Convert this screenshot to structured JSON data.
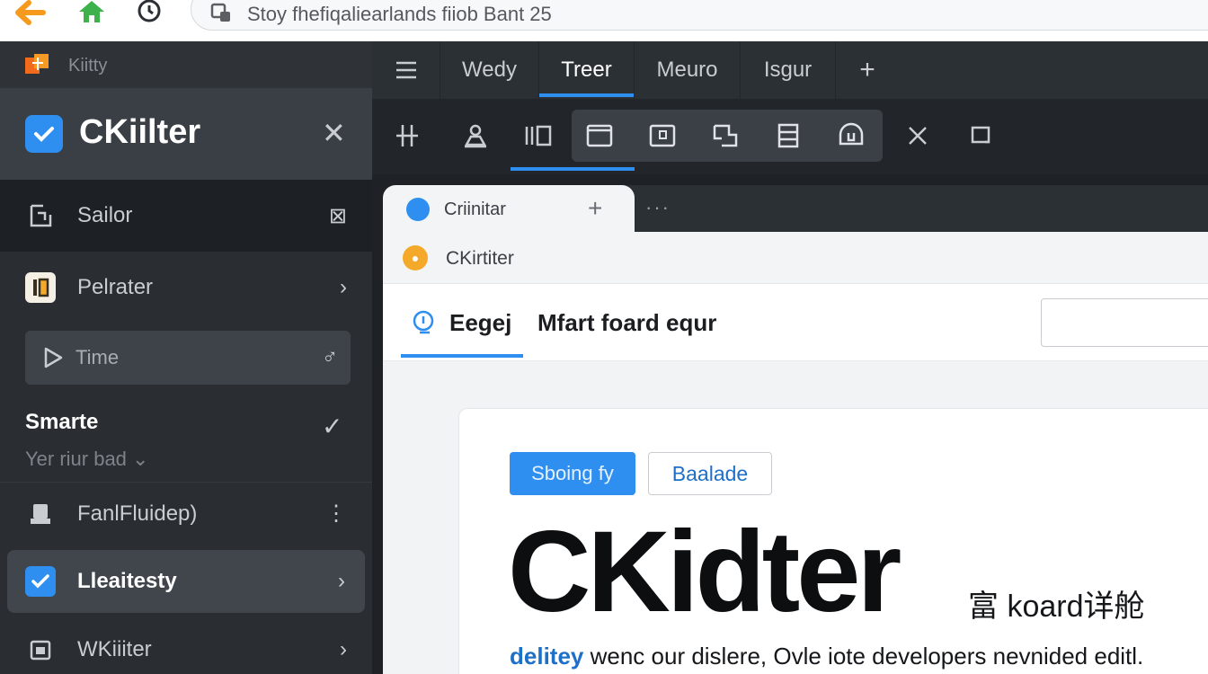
{
  "browser_bar": {
    "url_text": "Stoy fhefiqaliearlands fiiob Bant 25"
  },
  "sidebar": {
    "brand": "Kiitty",
    "app_title": "CKiilter",
    "items": [
      {
        "label": "Sailor",
        "trail": "⊠"
      },
      {
        "label": "Pelrater",
        "trail": "›"
      },
      {
        "label": "Time",
        "trail": "♂"
      }
    ],
    "section": {
      "title": "Smarte",
      "subtitle": "Yer riur bad"
    },
    "lower_items": [
      {
        "label": "FanlFluidep)",
        "trail": "⋮"
      },
      {
        "label": "Lleaitesty",
        "trail": "›"
      },
      {
        "label": "WKiiiter",
        "trail": "›"
      }
    ]
  },
  "header": {
    "tabs": [
      {
        "label": "Wedy"
      },
      {
        "label": "Treer"
      },
      {
        "label": "Meuro"
      },
      {
        "label": "Isgur"
      }
    ],
    "add_tab": "+"
  },
  "browser": {
    "tab_label": "Criinitar",
    "tab_add": "+",
    "tab_more": "···",
    "address_text": "CKirtiter",
    "page_tab_label": "Eegej",
    "page_title": "Mfart foard equr",
    "primary_button": "Sboing fy",
    "secondary_button": "Baalade",
    "hero_title": "CKidter",
    "hero_subtitle": "富 koard详舱",
    "description_highlight": "delitey",
    "description_text": " wenc our dislere, Ovle iote developers nevnided editl."
  },
  "colors": {
    "accent": "#2e8ff0",
    "sidebar_bg": "#2a2e33",
    "header_bg": "#2b3035",
    "toolbar_bg": "#22262a"
  }
}
